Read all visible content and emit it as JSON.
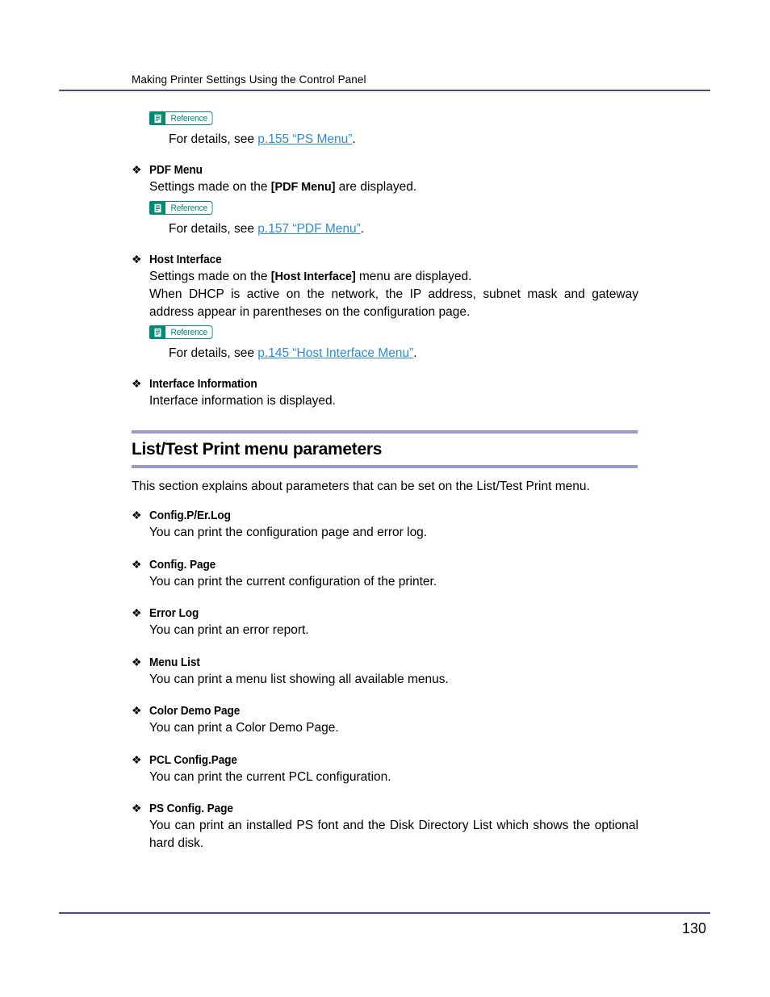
{
  "header": {
    "title": "Making Printer Settings Using the Control Panel"
  },
  "reference_badge": {
    "label": "Reference",
    "icon": "document-icon",
    "color": "#018a74"
  },
  "top_references": [
    {
      "prefix": "For details, see ",
      "link": "p.155 “PS Menu”",
      "suffix": "."
    }
  ],
  "bullets": [
    {
      "title": "PDF Menu",
      "body_pre": "Settings made on the ",
      "body_key": "[PDF Menu]",
      "body_post": " are displayed.",
      "reference": {
        "prefix": "For details, see ",
        "link": "p.157 “PDF Menu”",
        "suffix": "."
      }
    },
    {
      "title": "Host Interface",
      "body_pre": "Settings made on the ",
      "body_key": "[Host Interface]",
      "body_post": " menu are displayed.",
      "body_extra": "When DHCP is active on the network, the IP address, subnet mask and gateway address appear in parentheses on the configuration page.",
      "reference": {
        "prefix": "For details, see ",
        "link": "p.145 “Host Interface Menu”",
        "suffix": "."
      }
    },
    {
      "title": "Interface Information",
      "body_plain": "Interface information is displayed."
    }
  ],
  "section": {
    "title": "List/Test Print menu parameters",
    "intro": "This section explains about parameters that can be set on the List/Test Print menu.",
    "rule_color": "#9a9ac8"
  },
  "parameters": [
    {
      "title": "Config.P/Er.Log",
      "body": "You can print the configuration page and error log."
    },
    {
      "title": "Config. Page",
      "body": "You can print the current configuration of the printer."
    },
    {
      "title": "Error Log",
      "body": "You can print an error report."
    },
    {
      "title": "Menu List",
      "body": "You can print a menu list showing all available menus."
    },
    {
      "title": "Color Demo Page",
      "body": "You can print a Color Demo Page."
    },
    {
      "title": "PCL Config.Page",
      "body": "You can print the current PCL configuration."
    },
    {
      "title": "PS Config. Page",
      "body": "You can print an installed PS font and the Disk Directory List which shows the optional hard disk."
    }
  ],
  "bullet_glyph": "❖",
  "footer": {
    "page_number": "130",
    "rule_color": "#4a4a80"
  },
  "link_color": "#2b8bd6"
}
